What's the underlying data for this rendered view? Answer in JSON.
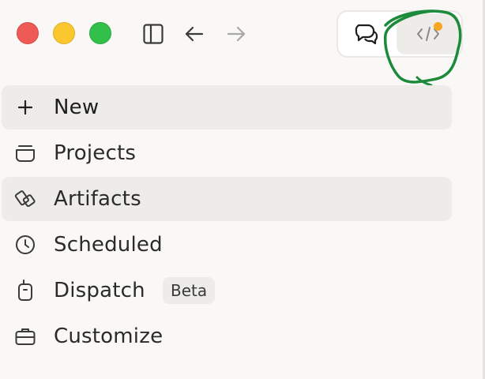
{
  "window": {
    "controls": {
      "close_color": "#ee5a55",
      "minimize_color": "#fbc72e",
      "zoom_color": "#33c04a"
    },
    "toolbar": {
      "sidebar_toggle_icon": "sidebar-toggle-icon",
      "back_icon": "arrow-left-icon",
      "forward_icon": "arrow-right-icon",
      "forward_enabled": false
    },
    "mode_switch": {
      "options": [
        {
          "icon": "chat-bubbles-icon",
          "selected": false
        },
        {
          "icon": "code-icon",
          "selected": true,
          "badge_dot_color": "#f6a623"
        }
      ],
      "annotation_color": "#1b8a3a"
    }
  },
  "sidebar": {
    "items": [
      {
        "icon": "plus-icon",
        "label": "New",
        "active": true
      },
      {
        "icon": "projects-tray-icon",
        "label": "Projects",
        "active": false
      },
      {
        "icon": "artifacts-shapes-icon",
        "label": "Artifacts",
        "active": true
      },
      {
        "icon": "clock-icon",
        "label": "Scheduled",
        "active": false
      },
      {
        "icon": "device-icon",
        "label": "Dispatch",
        "active": false,
        "badge": "Beta"
      },
      {
        "icon": "briefcase-icon",
        "label": "Customize",
        "active": false
      }
    ]
  }
}
